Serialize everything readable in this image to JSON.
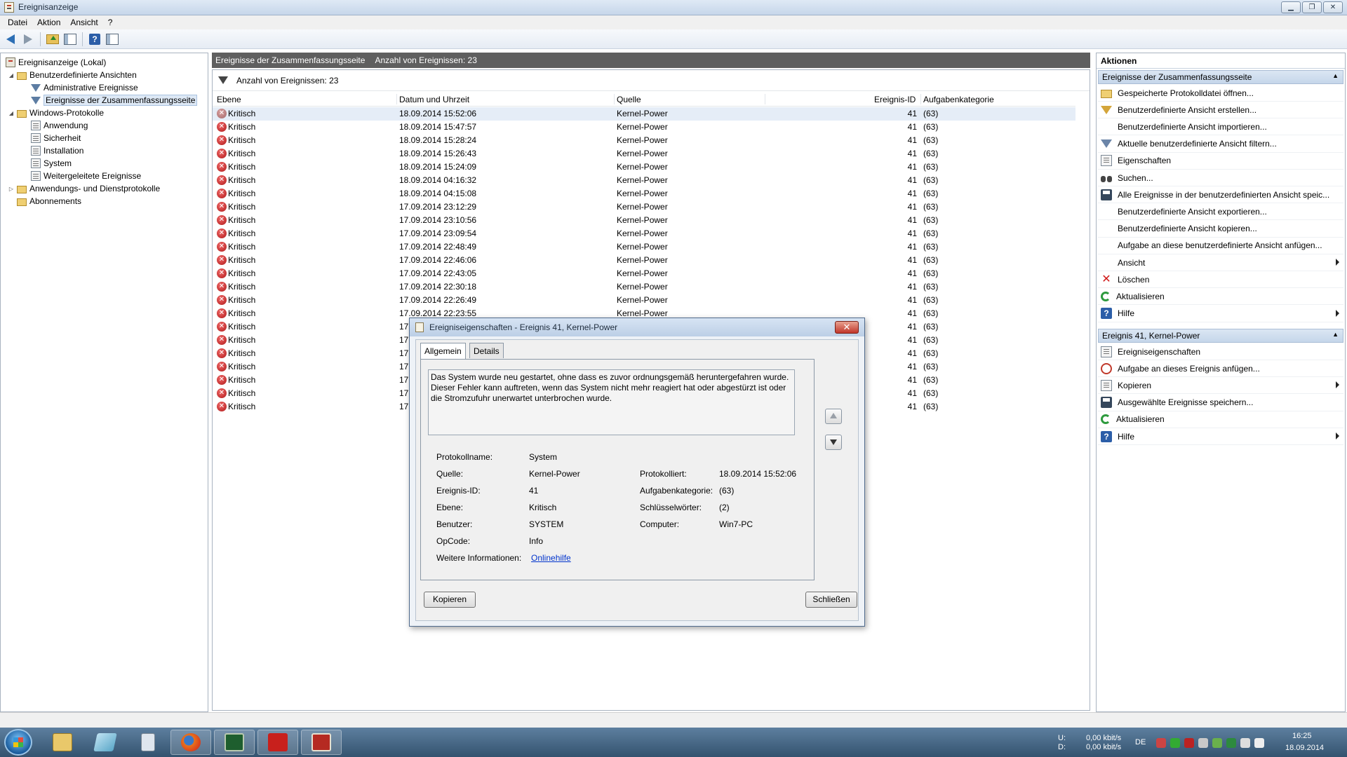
{
  "window": {
    "title": "Ereignisanzeige",
    "minimize": "▁",
    "restore": "❐",
    "close": "✕"
  },
  "menu": [
    "Datei",
    "Aktion",
    "Ansicht",
    "?"
  ],
  "tree": [
    {
      "label": "Ereignisanzeige (Lokal)",
      "icon": "computer-icon",
      "expand": ""
    },
    {
      "label": "Benutzerdefinierte Ansichten",
      "icon": "folder-icon",
      "expand": "◢"
    },
    {
      "label": "Administrative Ereignisse",
      "icon": "filter-icon",
      "expand": ""
    },
    {
      "label": "Ereignisse der Zusammenfassungsseite",
      "icon": "filter-icon",
      "expand": ""
    },
    {
      "label": "Windows-Protokolle",
      "icon": "folder-icon",
      "expand": "◢"
    },
    {
      "label": "Anwendung",
      "icon": "log-icon",
      "expand": ""
    },
    {
      "label": "Sicherheit",
      "icon": "log-icon",
      "expand": ""
    },
    {
      "label": "Installation",
      "icon": "log-icon",
      "expand": ""
    },
    {
      "label": "System",
      "icon": "log-icon",
      "expand": ""
    },
    {
      "label": "Weitergeleitete Ereignisse",
      "icon": "log-icon",
      "expand": ""
    },
    {
      "label": "Anwendungs- und Dienstprotokolle",
      "icon": "folder-icon",
      "expand": "▷"
    },
    {
      "label": "Abonnements",
      "icon": "folder-icon",
      "expand": ""
    }
  ],
  "center": {
    "header_title": "Ereignisse der Zusammenfassungsseite",
    "header_count": "Anzahl von Ereignissen: 23",
    "filter_text": "Anzahl von Ereignissen: 23",
    "columns": [
      "Ebene",
      "Datum und Uhrzeit",
      "Quelle",
      "Ereignis-ID",
      "Aufgabenkategorie"
    ],
    "rows": [
      {
        "level": "Kritisch",
        "date": "18.09.2014 15:52:06",
        "source": "Kernel-Power",
        "id": "41",
        "task": "(63)"
      },
      {
        "level": "Kritisch",
        "date": "18.09.2014 15:47:57",
        "source": "Kernel-Power",
        "id": "41",
        "task": "(63)"
      },
      {
        "level": "Kritisch",
        "date": "18.09.2014 15:28:24",
        "source": "Kernel-Power",
        "id": "41",
        "task": "(63)"
      },
      {
        "level": "Kritisch",
        "date": "18.09.2014 15:26:43",
        "source": "Kernel-Power",
        "id": "41",
        "task": "(63)"
      },
      {
        "level": "Kritisch",
        "date": "18.09.2014 15:24:09",
        "source": "Kernel-Power",
        "id": "41",
        "task": "(63)"
      },
      {
        "level": "Kritisch",
        "date": "18.09.2014 04:16:32",
        "source": "Kernel-Power",
        "id": "41",
        "task": "(63)"
      },
      {
        "level": "Kritisch",
        "date": "18.09.2014 04:15:08",
        "source": "Kernel-Power",
        "id": "41",
        "task": "(63)"
      },
      {
        "level": "Kritisch",
        "date": "17.09.2014 23:12:29",
        "source": "Kernel-Power",
        "id": "41",
        "task": "(63)"
      },
      {
        "level": "Kritisch",
        "date": "17.09.2014 23:10:56",
        "source": "Kernel-Power",
        "id": "41",
        "task": "(63)"
      },
      {
        "level": "Kritisch",
        "date": "17.09.2014 23:09:54",
        "source": "Kernel-Power",
        "id": "41",
        "task": "(63)"
      },
      {
        "level": "Kritisch",
        "date": "17.09.2014 22:48:49",
        "source": "Kernel-Power",
        "id": "41",
        "task": "(63)"
      },
      {
        "level": "Kritisch",
        "date": "17.09.2014 22:46:06",
        "source": "Kernel-Power",
        "id": "41",
        "task": "(63)"
      },
      {
        "level": "Kritisch",
        "date": "17.09.2014 22:43:05",
        "source": "Kernel-Power",
        "id": "41",
        "task": "(63)"
      },
      {
        "level": "Kritisch",
        "date": "17.09.2014 22:30:18",
        "source": "Kernel-Power",
        "id": "41",
        "task": "(63)"
      },
      {
        "level": "Kritisch",
        "date": "17.09.2014 22:26:49",
        "source": "Kernel-Power",
        "id": "41",
        "task": "(63)"
      },
      {
        "level": "Kritisch",
        "date": "17.09.2014 22:23:55",
        "source": "Kernel-Power",
        "id": "41",
        "task": "(63)"
      },
      {
        "level": "Kritisch",
        "date": "17.",
        "source": "",
        "id": "41",
        "task": "(63)"
      },
      {
        "level": "Kritisch",
        "date": "17.",
        "source": "",
        "id": "41",
        "task": "(63)"
      },
      {
        "level": "Kritisch",
        "date": "17.",
        "source": "",
        "id": "41",
        "task": "(63)"
      },
      {
        "level": "Kritisch",
        "date": "17.",
        "source": "",
        "id": "41",
        "task": "(63)"
      },
      {
        "level": "Kritisch",
        "date": "17.",
        "source": "",
        "id": "41",
        "task": "(63)"
      },
      {
        "level": "Kritisch",
        "date": "17.",
        "source": "",
        "id": "41",
        "task": "(63)"
      },
      {
        "level": "Kritisch",
        "date": "17.",
        "source": "",
        "id": "41",
        "task": "(63)"
      }
    ]
  },
  "actions": {
    "title": "Aktionen",
    "section1": "Ereignisse der Zusammenfassungsseite",
    "items1": [
      {
        "label": "Gespeicherte Protokolldatei öffnen...",
        "icon": "open-folder-icon",
        "sub": false
      },
      {
        "label": "Benutzerdefinierte Ansicht erstellen...",
        "icon": "create-filter-icon",
        "sub": false
      },
      {
        "label": "Benutzerdefinierte Ansicht importieren...",
        "icon": "",
        "sub": false
      },
      {
        "label": "Aktuelle benutzerdefinierte Ansicht filtern...",
        "icon": "filter-icon",
        "sub": false
      },
      {
        "label": "Eigenschaften",
        "icon": "properties-icon",
        "sub": false
      },
      {
        "label": "Suchen...",
        "icon": "binoculars-icon",
        "sub": false
      },
      {
        "label": "Alle Ereignisse in der benutzerdefinierten Ansicht speic...",
        "icon": "save-icon",
        "sub": false
      },
      {
        "label": "Benutzerdefinierte Ansicht exportieren...",
        "icon": "",
        "sub": false
      },
      {
        "label": "Benutzerdefinierte Ansicht kopieren...",
        "icon": "",
        "sub": false
      },
      {
        "label": "Aufgabe an diese benutzerdefinierte Ansicht anfügen...",
        "icon": "",
        "sub": false
      },
      {
        "label": "Ansicht",
        "icon": "",
        "sub": true
      },
      {
        "label": "Löschen",
        "icon": "delete-icon",
        "sub": false
      },
      {
        "label": "Aktualisieren",
        "icon": "refresh-icon",
        "sub": false
      },
      {
        "label": "Hilfe",
        "icon": "help-icon",
        "sub": true
      }
    ],
    "section2": "Ereignis 41, Kernel-Power",
    "items2": [
      {
        "label": "Ereigniseigenschaften",
        "icon": "event-properties-icon",
        "sub": false
      },
      {
        "label": "Aufgabe an dieses Ereignis anfügen...",
        "icon": "attach-task-icon",
        "sub": false
      },
      {
        "label": "Kopieren",
        "icon": "copy-icon",
        "sub": true
      },
      {
        "label": "Ausgewählte Ereignisse speichern...",
        "icon": "save-icon",
        "sub": false
      },
      {
        "label": "Aktualisieren",
        "icon": "refresh-icon",
        "sub": false
      },
      {
        "label": "Hilfe",
        "icon": "help-icon",
        "sub": true
      }
    ]
  },
  "dialog": {
    "title": "Ereigniseigenschaften - Ereignis 41, Kernel-Power",
    "close": "✕",
    "tab_general": "Allgemein",
    "tab_details": "Details",
    "description": "Das System wurde neu gestartet, ohne dass es zuvor ordnungsgemäß heruntergefahren wurde. Dieser Fehler kann auftreten, wenn das System nicht mehr reagiert hat oder abgestürzt ist oder die Stromzufuhr unerwartet unterbrochen wurde.",
    "labels": {
      "log_name": "Protokollname:",
      "source": "Quelle:",
      "event_id": "Ereignis-ID:",
      "level": "Ebene:",
      "user": "Benutzer:",
      "opcode": "OpCode:",
      "more_info": "Weitere Informationen:",
      "logged": "Protokolliert:",
      "task_category": "Aufgabenkategorie:",
      "keywords": "Schlüsselwörter:",
      "computer": "Computer:"
    },
    "values": {
      "log_name": "System",
      "source": "Kernel-Power",
      "event_id": "41",
      "level": "Kritisch",
      "user": "SYSTEM",
      "opcode": "Info",
      "more_info": "Onlinehilfe",
      "logged": "18.09.2014 15:52:06",
      "task_category": "(63)",
      "keywords": "(2)",
      "computer": "Win7-PC"
    },
    "copy_button": "Kopieren",
    "close_button": "Schließen"
  },
  "taskbar": {
    "tray_drive_u": "U:",
    "tray_drive_d": "D:",
    "tray_rate_up": "0,00 kbit/s",
    "tray_rate_down": "0,00 kbit/s",
    "language": "DE",
    "time": "16:25",
    "date": "18.09.2014"
  }
}
